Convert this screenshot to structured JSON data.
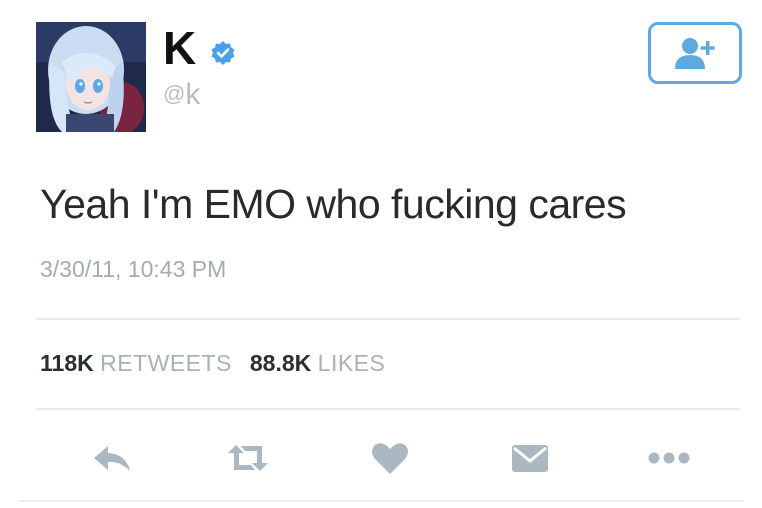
{
  "user": {
    "display_name": "K",
    "handle_at": "@",
    "handle": "k",
    "verified": true,
    "avatar_icon": "anime-girl-avatar"
  },
  "follow_button": {
    "icon": "add-user-icon"
  },
  "tweet": {
    "text": "Yeah I'm EMO who fucking cares",
    "timestamp": "3/30/11, 10:43 PM"
  },
  "stats": {
    "retweets_count": "118K",
    "retweets_label": "RETWEETS",
    "likes_count": "88.8K",
    "likes_label": "LIKES"
  },
  "actions": [
    "reply-icon",
    "retweet-icon",
    "like-icon",
    "direct-message-icon",
    "more-icon"
  ],
  "colors": {
    "accent": "#5eaade",
    "icon_gray": "#aab8c2",
    "text": "#2a2a2a",
    "muted": "#a3abb3"
  }
}
